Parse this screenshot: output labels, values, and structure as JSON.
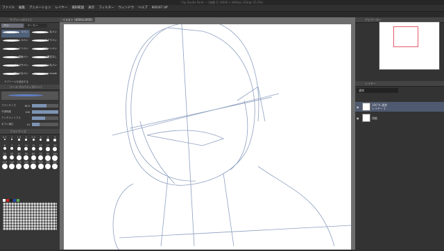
{
  "window": {
    "title": "Clip Studio Paint — [無題-1] (4000 x 3000px 350dpi 25.0%)"
  },
  "menu": [
    "ファイル",
    "編集",
    "アニメーション",
    "レイヤー",
    "選択範囲",
    "表示",
    "フィルター",
    "ウィンドウ",
    "ヘルプ",
    "BOOST UP"
  ],
  "left": {
    "tool_panel_title": "サブツール[ペン]",
    "tabs": [
      "ペン",
      "マーカー"
    ],
    "brushes": [
      "Gペン",
      "丸ペン",
      "リアル Gペン",
      "カブラペン",
      "ミリペン",
      "スプーンペン",
      "漫画ペン",
      "筆圧なし",
      "ガサガサペン",
      "リアル丸ペン",
      "滑らかなペン",
      "Kaito pencil shade"
    ],
    "add_subtool": "サブツールを追加する",
    "props_title": "ツールプロパティ[Gペン]",
    "props": [
      {
        "label": "ブラシサイズ",
        "value": "18.0",
        "level": 0.55
      },
      {
        "label": "不透明度",
        "value": "100",
        "level": 1.0
      },
      {
        "label": "アンチエイリアス",
        "value": "",
        "level": 0.5
      },
      {
        "label": "手ブレ補正",
        "value": "15",
        "level": 0.3
      }
    ],
    "size_title": "ブラシサイズ",
    "sizes": [
      "0.7",
      "1",
      "1.5",
      "2",
      "2.5",
      "3",
      "4",
      "5",
      "6",
      "7",
      "8",
      "10",
      "12",
      "15",
      "17",
      "20",
      "25",
      "30",
      "40",
      "50",
      "60",
      "70",
      "80",
      "100",
      "120",
      "150",
      "170",
      "200",
      "250",
      "300",
      "400",
      "500"
    ],
    "colors": [
      "#ffffff",
      "#d02020",
      "#222222",
      "#2244aa",
      "#55aa55"
    ]
  },
  "canvas": {
    "doc_tab": "イラスト (4000x3000)",
    "background": "#ffffff",
    "sketch_color": "#7088b0"
  },
  "right": {
    "nav_title": "ナビゲーター",
    "layer_panel_title": "レイヤー",
    "blend_mode": "通常",
    "layers": [
      {
        "name": "100 % 通常",
        "sub": "レイヤー 1",
        "selected": true
      },
      {
        "name": "用紙",
        "sub": "",
        "selected": false
      }
    ]
  }
}
